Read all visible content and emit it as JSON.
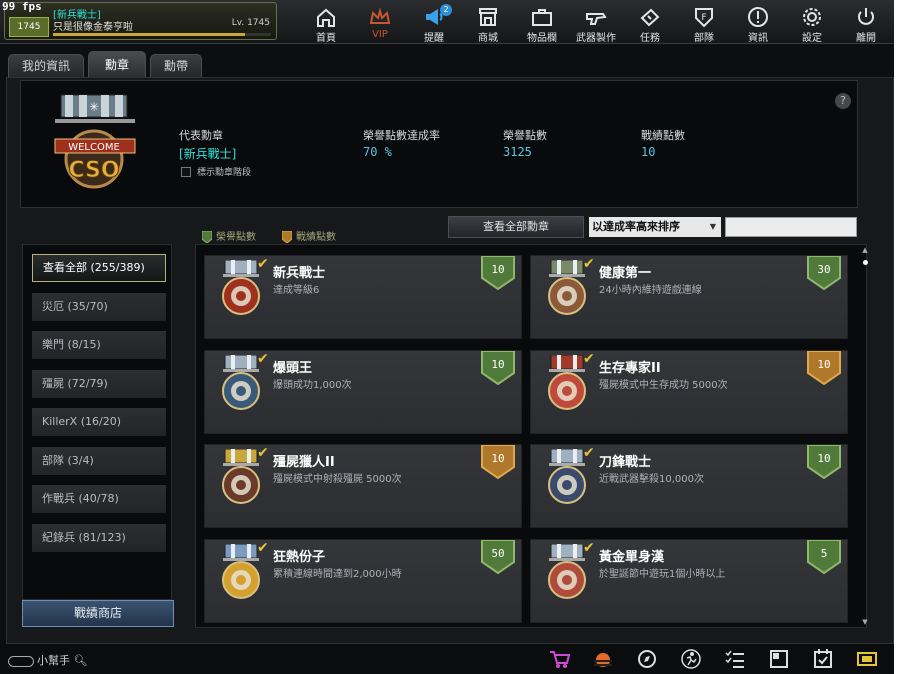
{
  "fps": "99 fps",
  "profile": {
    "level_badge": "1745",
    "name": "[新兵戰士]",
    "motto": "只是很像金泰亨啦",
    "level": "Lv. 1745",
    "exp_fraction": 0.88
  },
  "nav": [
    {
      "label": "首頁",
      "icon": "home-icon"
    },
    {
      "label": "VIP",
      "icon": "crown-icon"
    },
    {
      "label": "提醒",
      "icon": "megaphone-icon",
      "badge": "2"
    },
    {
      "label": "商城",
      "icon": "shop-icon"
    },
    {
      "label": "物品欄",
      "icon": "briefcase-icon"
    },
    {
      "label": "武器製作",
      "icon": "gun-icon"
    },
    {
      "label": "任務",
      "icon": "ticket-icon"
    },
    {
      "label": "部隊",
      "icon": "clan-shield-icon"
    },
    {
      "label": "資訊",
      "icon": "info-icon"
    },
    {
      "label": "設定",
      "icon": "gear-icon"
    },
    {
      "label": "離開",
      "icon": "power-icon"
    }
  ],
  "tabs": [
    "我的資訊",
    "勳章",
    "勳帶"
  ],
  "active_tab": 1,
  "summary": {
    "rep_label": "代表勳章",
    "rep_value": "[新兵戰士]",
    "show_tier_label": "標示勳章階段",
    "honor_rate_label": "榮譽點數達成率",
    "honor_rate_value": "70 %",
    "honor_label": "榮譽點數",
    "honor_value": "3125",
    "battle_label": "戰績點數",
    "battle_value": "10",
    "emblem_line1": "WELCOME",
    "emblem_line2": "CSO"
  },
  "legend": {
    "honor": "榮譽點數",
    "battle": "戰績點數",
    "honor_color": "#4f7a3a",
    "battle_color": "#b0782a"
  },
  "view_all_button": "查看全部勳章",
  "sort": {
    "selected": "以達成率高來排序"
  },
  "categories": [
    "查看全部 (255/389)",
    "災厄 (35/70)",
    "樂門 (8/15)",
    "殭屍 (72/79)",
    "KillerX (16/20)",
    "部隊 (3/4)",
    "作戰兵 (40/78)",
    "紀錄兵 (81/123)"
  ],
  "shop_button": "戰績商店",
  "medals": [
    {
      "name": "新兵戰士",
      "desc": "達成等級6",
      "points": "10",
      "type": "honor",
      "icon": "welcome-cso-medal-icon"
    },
    {
      "name": "健康第一",
      "desc": "24小時內維持遊戲連線",
      "points": "30",
      "type": "honor",
      "icon": "star-medal-icon"
    },
    {
      "name": "爆頭王",
      "desc": "爆頭成功1,000次",
      "points": "10",
      "type": "honor",
      "icon": "skull-medal-icon"
    },
    {
      "name": "生存專家II",
      "desc": "殭屍模式中生存成功 5000次",
      "points": "10",
      "type": "battle",
      "icon": "survivor-medal-icon"
    },
    {
      "name": "殭屍獵人II",
      "desc": "殭屍模式中射殺殭屍 5000次",
      "points": "10",
      "type": "battle",
      "icon": "zombie-hunter-medal-icon"
    },
    {
      "name": "刀鋒戰士",
      "desc": "近戰武器擊殺10,000次",
      "points": "10",
      "type": "honor",
      "icon": "blade-medal-icon"
    },
    {
      "name": "狂熱份子",
      "desc": "累積連線時間達到2,000小時",
      "points": "50",
      "type": "honor",
      "icon": "gold-cso-medal-icon"
    },
    {
      "name": "黃金單身漢",
      "desc": "於聖誕節中遊玩1個小時以上",
      "points": "5",
      "type": "honor",
      "icon": "bachelor-medal-icon"
    }
  ],
  "bottom": {
    "helper": "小幫手"
  }
}
